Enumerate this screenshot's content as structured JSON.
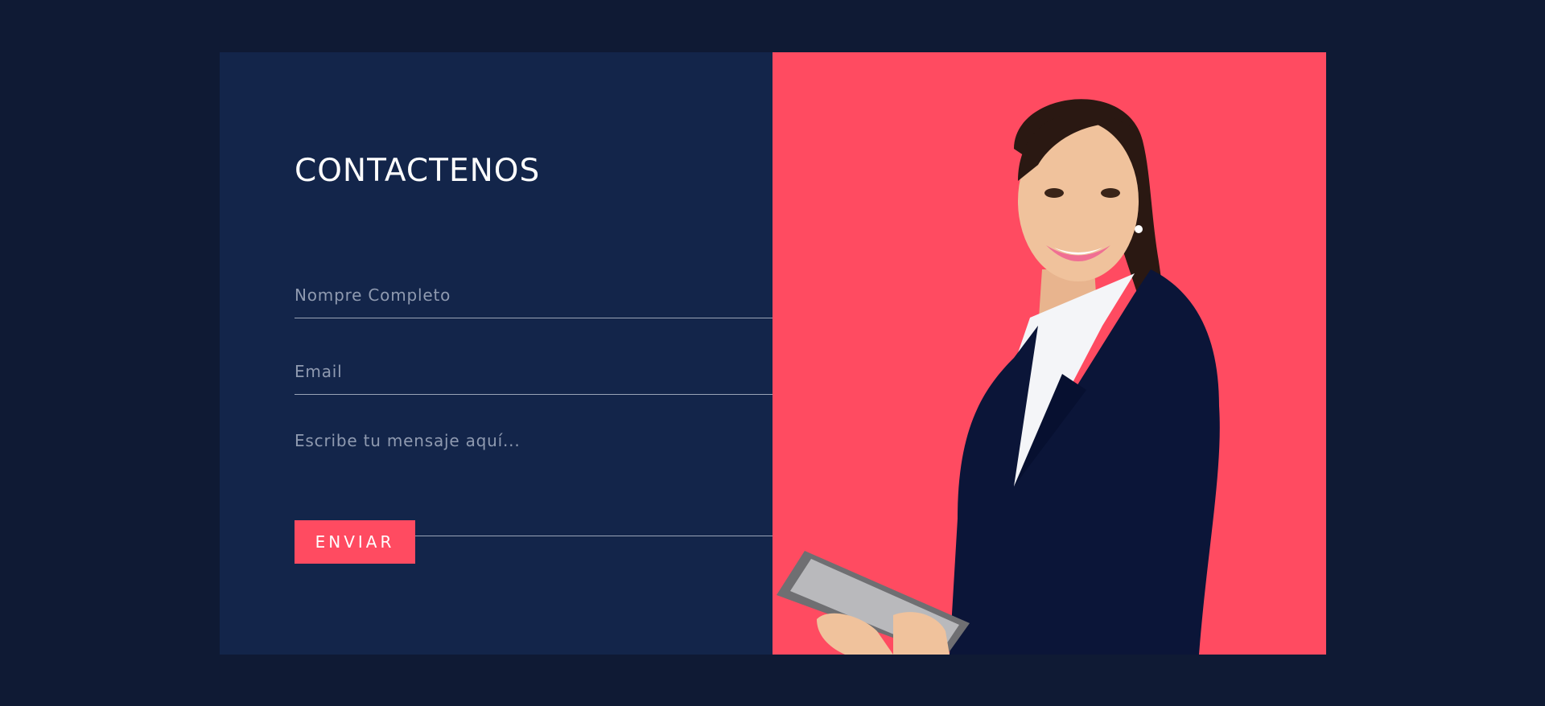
{
  "contact": {
    "title": "CONTACTENOS",
    "name_placeholder": "Nompre Completo",
    "email_placeholder": "Email",
    "message_placeholder": "Escribe tu mensaje aquí...",
    "submit_label": "ENVIAR"
  },
  "colors": {
    "page_background": "#0f1a34",
    "form_panel": "#13254a",
    "accent": "#ff4b61"
  },
  "image": {
    "subject": "smiling businesswoman in navy suit holding a tablet"
  }
}
